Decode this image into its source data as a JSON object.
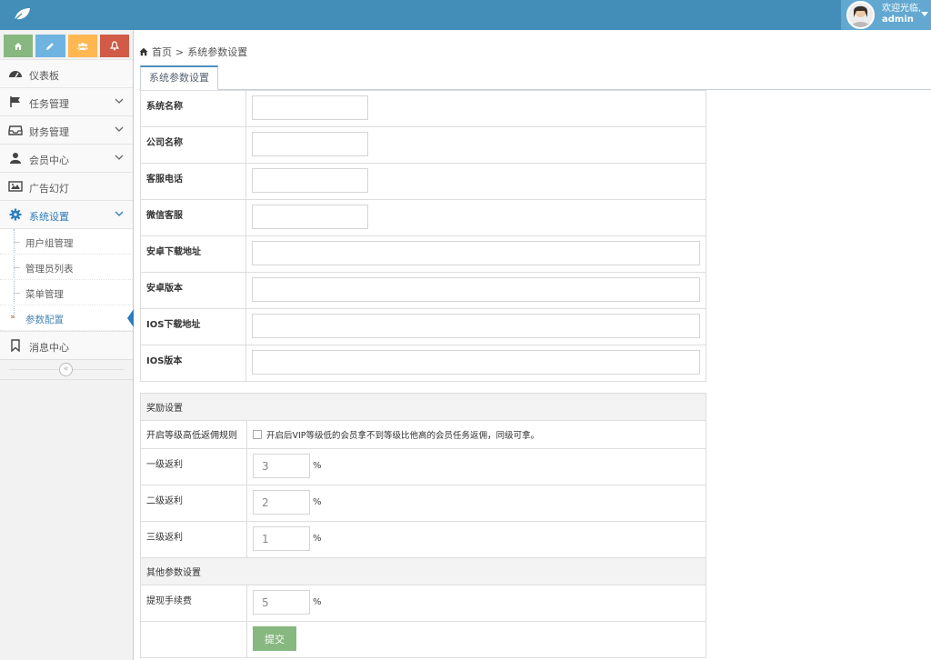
{
  "header": {
    "welcome": "欢迎光临,",
    "username": "admin"
  },
  "sidebar": {
    "shortcuts": [
      "home-icon",
      "pencil-icon",
      "users-icon",
      "bell-icon"
    ],
    "items": [
      {
        "label": "仪表板",
        "icon": "dashboard-icon"
      },
      {
        "label": "任务管理",
        "icon": "flag-icon"
      },
      {
        "label": "财务管理",
        "icon": "inbox-icon"
      },
      {
        "label": "会员中心",
        "icon": "user-icon"
      },
      {
        "label": "广告幻灯",
        "icon": "picture-icon"
      },
      {
        "label": "系统设置",
        "icon": "gear-icon"
      },
      {
        "label": "消息中心",
        "icon": "bookmark-icon"
      }
    ],
    "submenu": [
      "用户组管理",
      "管理员列表",
      "菜单管理",
      "参数配置"
    ]
  },
  "breadcrumb": {
    "home": "首页",
    "sep": ">",
    "current": "系统参数设置"
  },
  "tab": "系统参数设置",
  "basic": [
    {
      "label": "系统名称",
      "value": ""
    },
    {
      "label": "公司名称",
      "value": ""
    },
    {
      "label": "客服电话",
      "value": ""
    },
    {
      "label": "微信客服",
      "value": ""
    },
    {
      "label": "安卓下载地址",
      "value": ""
    },
    {
      "label": "安卓版本",
      "value": ""
    },
    {
      "label": "IOS下载地址",
      "value": ""
    },
    {
      "label": "IOS版本",
      "value": ""
    }
  ],
  "reward": {
    "title": "奖励设置",
    "rule_label": "开启等级高低返佣规则",
    "rule_text": "开启后VIP等级低的会员拿不到等级比他高的会员任务返佣，同级可拿。",
    "levels": [
      {
        "label": "一级返利",
        "value": "3"
      },
      {
        "label": "二级返利",
        "value": "2"
      },
      {
        "label": "三级返利",
        "value": "1"
      }
    ],
    "unit": "%"
  },
  "other": {
    "title": "其他参数设置",
    "fee_label": "提现手续费",
    "fee_value": "5",
    "unit": "%",
    "submit": "提交"
  }
}
